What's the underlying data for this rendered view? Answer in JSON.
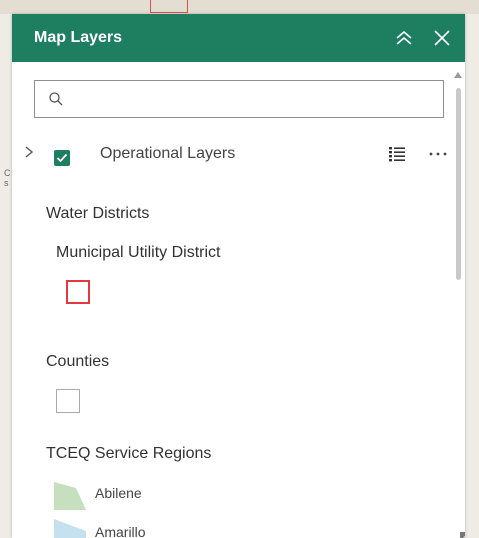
{
  "panel": {
    "title": "Map Layers"
  },
  "search": {
    "value": "",
    "placeholder": ""
  },
  "operational_layers": {
    "label": "Operational Layers",
    "checked": true
  },
  "legend": {
    "water_districts": {
      "title": "Water Districts",
      "item": "Municipal Utility District"
    },
    "counties": {
      "title": "Counties"
    },
    "service_regions": {
      "title": "TCEQ Service Regions",
      "items": [
        "Abilene",
        "Amarillo"
      ]
    }
  },
  "colors": {
    "header": "#1e7e60",
    "checkbox": "#1e7e60",
    "mud_symbol": "#e0393e",
    "abilene_fill": "#c6dfbf",
    "amarillo_fill": "#c5e1ef"
  },
  "icons": {
    "collapse": "double-chevron-up-icon",
    "close": "close-icon",
    "search": "search-icon",
    "expand": "chevron-right-icon",
    "legend": "legend-list-icon",
    "more": "more-options-icon"
  }
}
